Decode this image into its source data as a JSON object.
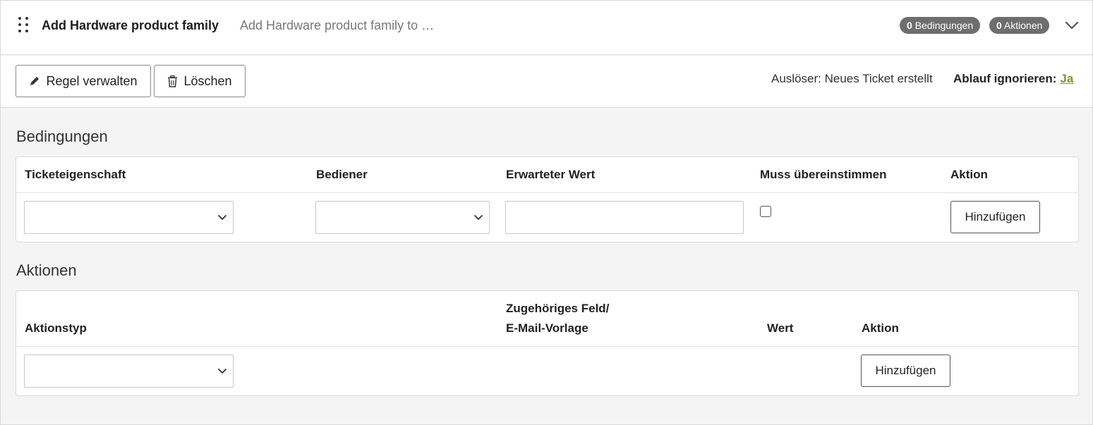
{
  "header": {
    "title": "Add Hardware product family",
    "description": "Add Hardware product family to …",
    "conditions_count": "0",
    "conditions_label": "Bedingungen",
    "actions_count": "0",
    "actions_label": "Aktionen"
  },
  "toolbar": {
    "manage_label": "Regel verwalten",
    "delete_label": "Löschen",
    "trigger_key": "Auslöser:",
    "trigger_value": "Neues Ticket erstellt",
    "ignore_key": "Ablauf ignorieren:",
    "ignore_value": "Ja"
  },
  "conditions": {
    "title": "Bedingungen",
    "columns": [
      "Ticketeigenschaft",
      "Bediener",
      "Erwarteter Wert",
      "Muss übereinstimmen",
      "Aktion"
    ],
    "add_label": "Hinzufügen",
    "property_value": "",
    "operator_value": "",
    "expected_value": "",
    "must_match": false
  },
  "actions": {
    "title": "Aktionen",
    "columns": [
      "Aktionstyp",
      "Zugehöriges Feld/",
      "E-Mail-Vorlage",
      "Wert",
      "Aktion"
    ],
    "add_label": "Hinzufügen",
    "type_value": ""
  },
  "colors": {
    "accent_link": "#7a9a1e",
    "badge_bg": "#6e6e6e"
  },
  "icons": [
    "drag-handle-icon",
    "chevron-down-icon",
    "pencil-icon",
    "trash-icon"
  ]
}
